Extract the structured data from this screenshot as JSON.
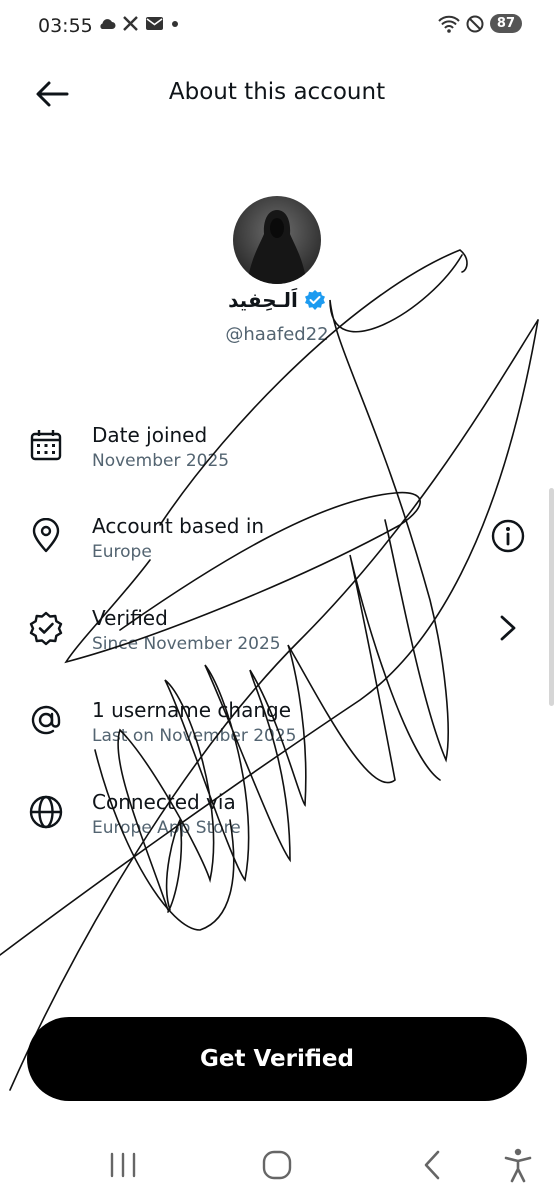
{
  "status_bar": {
    "time": "03:55",
    "left_icons": [
      "cloud-icon",
      "x-logo-icon",
      "mail-icon",
      "dot-icon"
    ],
    "right_icons": [
      "wifi-icon",
      "do-not-disturb-icon"
    ],
    "battery": "87"
  },
  "header": {
    "title": "About this account",
    "back_icon": "arrow-left-icon"
  },
  "profile": {
    "display_name": "اَلـحِفيد",
    "username": "@haafed22",
    "verified_color": "#1d9bf0"
  },
  "rows": [
    {
      "icon": "calendar-icon",
      "title": "Date joined",
      "subtitle": "November 2025"
    },
    {
      "icon": "location-pin-icon",
      "title": "Account based in",
      "subtitle": "Europe",
      "action_icon": "info-icon"
    },
    {
      "icon": "verified-badge-icon",
      "title": "Verified",
      "subtitle": "Since November 2025",
      "action_icon": "chevron-right-icon"
    },
    {
      "icon": "at-sign-icon",
      "title": "1 username change",
      "subtitle": "Last on November 2025"
    },
    {
      "icon": "globe-icon",
      "title": "Connected via",
      "subtitle": "Europe App Store"
    }
  ],
  "cta": {
    "label": "Get Verified"
  },
  "nav": [
    "recent-apps-icon",
    "home-icon",
    "back-icon",
    "accessibility-icon"
  ],
  "colors": {
    "text": "#0f1419",
    "secondary": "#536471",
    "button_bg": "#000000",
    "button_text": "#ffffff"
  }
}
